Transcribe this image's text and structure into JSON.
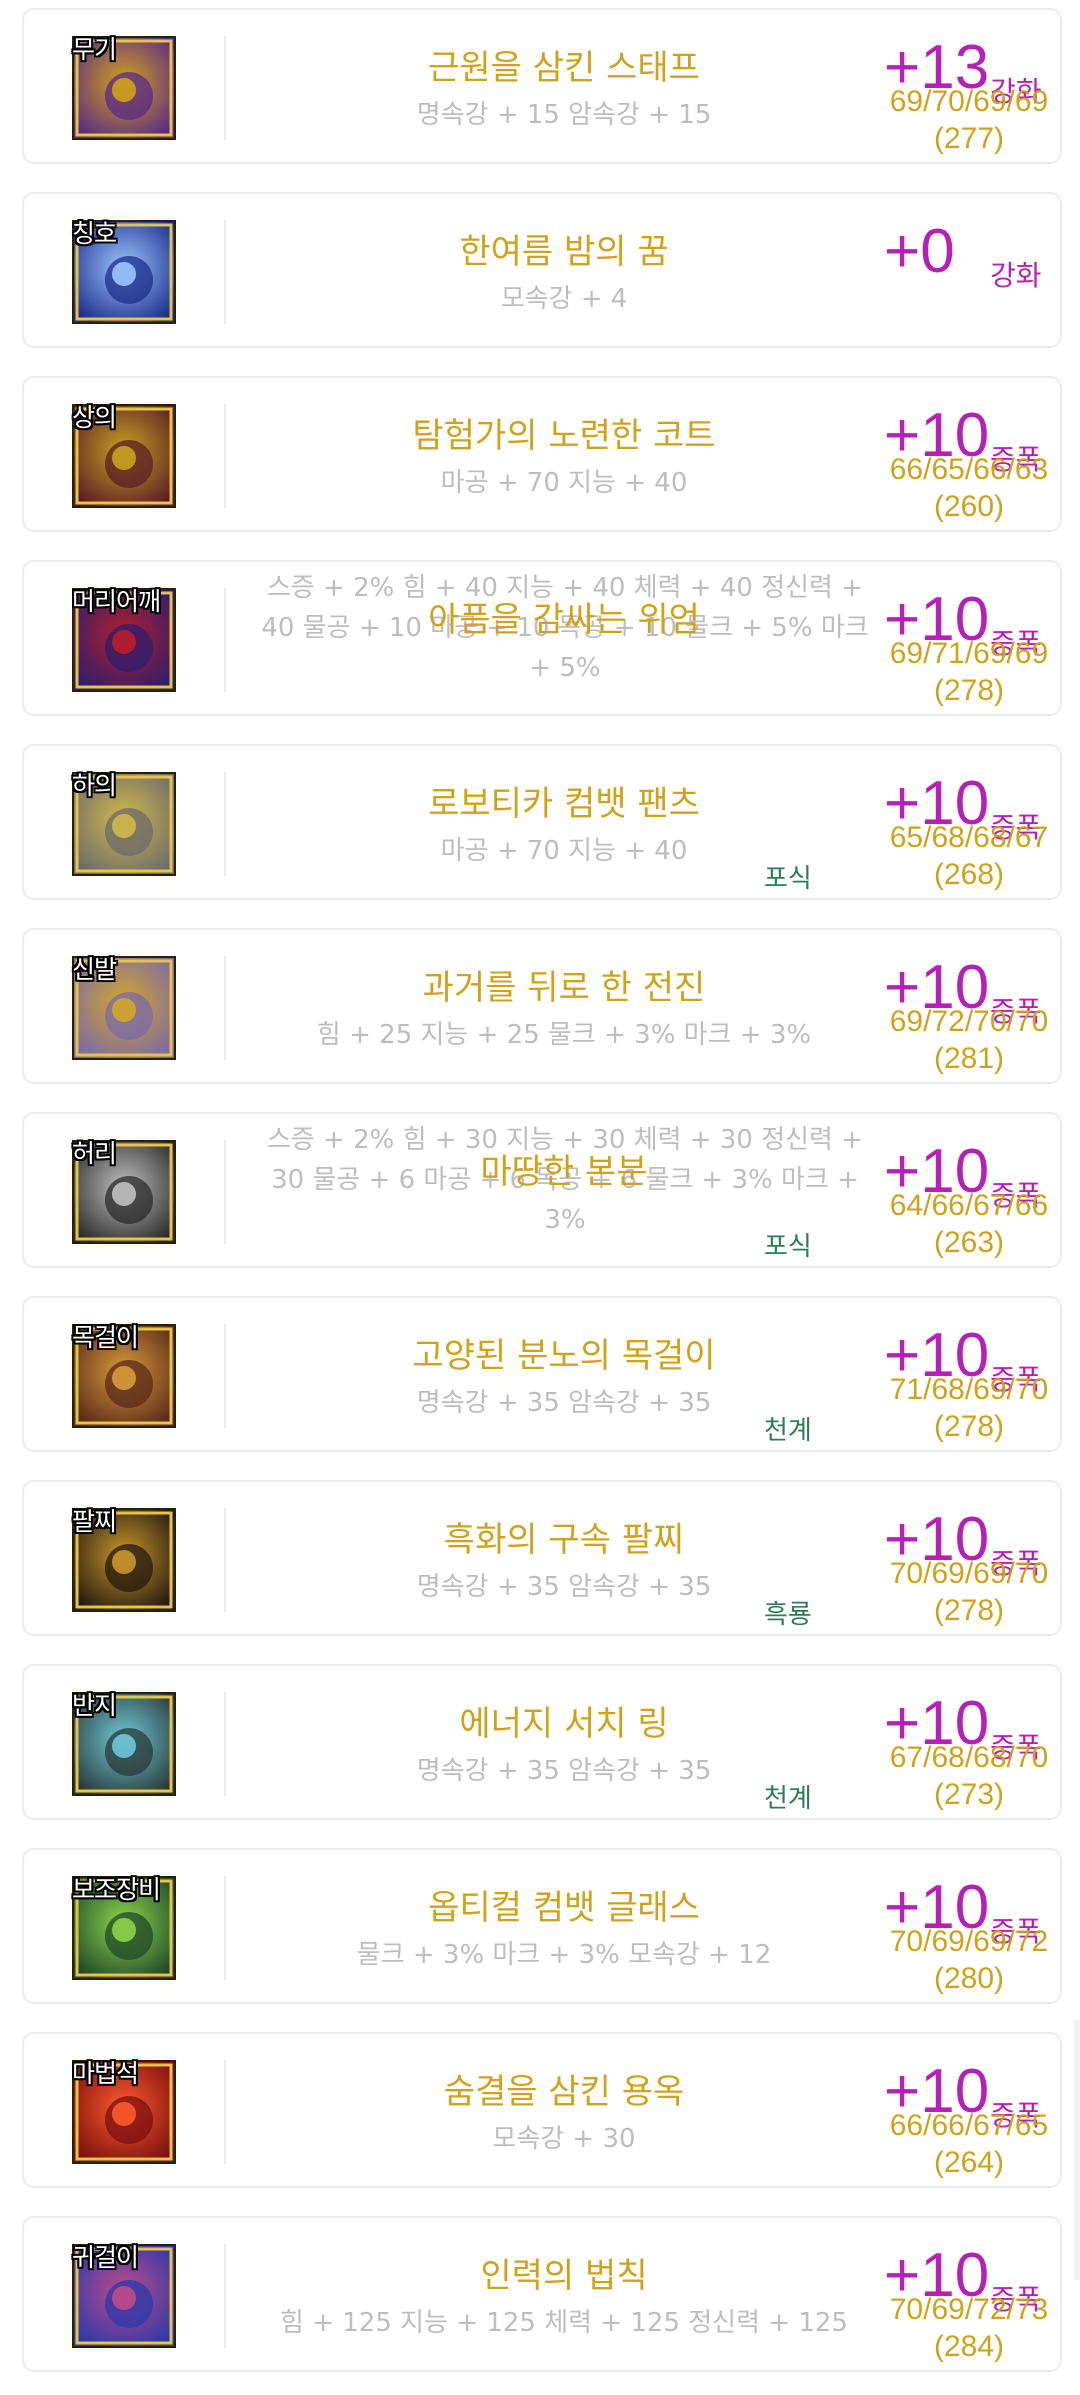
{
  "items": [
    {
      "slot": "무기",
      "name": "근원을 삼킨 스태프",
      "options": "명속강 + 15 암속강 + 15",
      "options_multi": false,
      "tag": "",
      "reinforce": "+13",
      "reinforce_type": "강화",
      "stats": "69/70/69/69",
      "total": "(277)",
      "icon": "weapon-staff-icon",
      "colors": [
        "#5a2a86",
        "#d3a21a"
      ]
    },
    {
      "slot": "칭호",
      "name": "한여름 밤의 꿈",
      "options": "모속강 + 4",
      "options_multi": false,
      "tag": "",
      "reinforce": "+0",
      "reinforce_type": "강화",
      "stats": "",
      "total": "",
      "icon": "title-night-sky-icon",
      "colors": [
        "#1b2f8a",
        "#9ec3ff"
      ]
    },
    {
      "slot": "상의",
      "name": "탐험가의 노련한 코트",
      "options": "마공 + 70 지능 + 40",
      "options_multi": false,
      "tag": "",
      "reinforce": "+10",
      "reinforce_type": "증폭",
      "stats": "66/65/66/63",
      "total": "(260)",
      "icon": "coat-icon",
      "colors": [
        "#5b1d25",
        "#c9a320"
      ]
    },
    {
      "slot": "머리어깨",
      "name": "아픔을 감싸는 위엄",
      "options": "스증 + 2% 힘 + 40 지능 + 40 체력 + 40 정신력 + 40 물공 + 10 마공 + 10 독공 + 10 물크 + 5% 마크 + 5%",
      "options_multi": true,
      "tag": "",
      "reinforce": "+10",
      "reinforce_type": "증폭",
      "stats": "69/71/69/69",
      "total": "(278)",
      "icon": "shoulder-cape-icon",
      "colors": [
        "#2c1d6e",
        "#b51e2a"
      ]
    },
    {
      "slot": "하의",
      "name": "로보티카 컴뱃 팬츠",
      "options": "마공 + 70 지능 + 40",
      "options_multi": false,
      "tag": "포식",
      "reinforce": "+10",
      "reinforce_type": "증폭",
      "stats": "65/68/68/67",
      "total": "(268)",
      "icon": "robotic-pants-icon",
      "colors": [
        "#6b6b6b",
        "#d2b94a"
      ]
    },
    {
      "slot": "신발",
      "name": "과거를 뒤로 한 전진",
      "options": "힘 + 25 지능 + 25 물크 + 3% 마크 + 3%",
      "options_multi": false,
      "tag": "",
      "reinforce": "+10",
      "reinforce_type": "증폭",
      "stats": "69/72/70/70",
      "total": "(281)",
      "icon": "boots-icon",
      "colors": [
        "#7a6aa8",
        "#d4a62a"
      ]
    },
    {
      "slot": "허리",
      "name": "마땅한 본분",
      "options": "스증 + 2% 힘 + 30 지능 + 30 체력 + 30 정신력 + 30 물공 + 6 마공 + 6 독공 + 6 물크 + 3% 마크 + 3%",
      "options_multi": true,
      "tag": "포식",
      "reinforce": "+10",
      "reinforce_type": "증폭",
      "stats": "64/66/67/66",
      "total": "(263)",
      "icon": "belt-mask-icon",
      "colors": [
        "#2b2b2b",
        "#c0c0c0"
      ]
    },
    {
      "slot": "목걸이",
      "name": "고양된 분노의 목걸이",
      "options": "명속강 + 35 암속강 + 35",
      "options_multi": false,
      "tag": "천계",
      "reinforce": "+10",
      "reinforce_type": "증폭",
      "stats": "71/68/69/70",
      "total": "(278)",
      "icon": "necklace-icon",
      "colors": [
        "#5a2a1a",
        "#d99a3a"
      ]
    },
    {
      "slot": "팔찌",
      "name": "흑화의 구속 팔찌",
      "options": "명속강 + 35 암속강 + 35",
      "options_multi": false,
      "tag": "흑룡",
      "reinforce": "+10",
      "reinforce_type": "증폭",
      "stats": "70/69/69/70",
      "total": "(278)",
      "icon": "bracelet-icon",
      "colors": [
        "#241a10",
        "#c8962a"
      ]
    },
    {
      "slot": "반지",
      "name": "에너지 서치 링",
      "options": "명속강 + 35 암속강 + 35",
      "options_multi": false,
      "tag": "천계",
      "reinforce": "+10",
      "reinforce_type": "증폭",
      "stats": "67/68/68/70",
      "total": "(273)",
      "icon": "ring-icon",
      "colors": [
        "#2a3a3a",
        "#6fc8d8"
      ]
    },
    {
      "slot": "보조장비",
      "name": "옵티컬 컴뱃 글래스",
      "options": "물크 + 3% 마크 + 3% 모속강 + 12",
      "options_multi": false,
      "tag": "",
      "reinforce": "+10",
      "reinforce_type": "증폭",
      "stats": "70/69/69/72",
      "total": "(280)",
      "icon": "glasses-icon",
      "colors": [
        "#1f4a2a",
        "#8fd44a"
      ]
    },
    {
      "slot": "마법석",
      "name": "숨결을 삼킨 용옥",
      "options": "모속강 + 30",
      "options_multi": false,
      "tag": "",
      "reinforce": "+10",
      "reinforce_type": "증폭",
      "stats": "66/66/67/65",
      "total": "(264)",
      "icon": "dragon-jade-icon",
      "colors": [
        "#7a1010",
        "#ff5a2a"
      ]
    },
    {
      "slot": "귀걸이",
      "name": "인력의 법칙",
      "options": "힘 + 125 지능 + 125 체력 + 125 정신력 + 125",
      "options_multi": false,
      "tag": "",
      "reinforce": "+10",
      "reinforce_type": "증폭",
      "stats": "70/69/72/73",
      "total": "(284)",
      "icon": "magnet-earring-icon",
      "colors": [
        "#2a3aa8",
        "#c04a8a"
      ]
    }
  ]
}
